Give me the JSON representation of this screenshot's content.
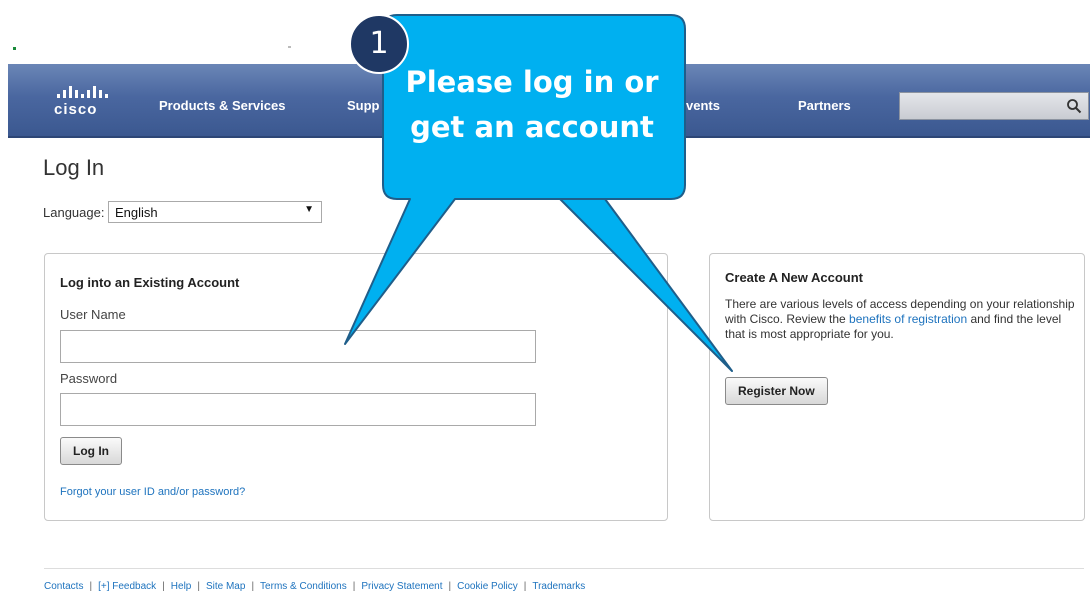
{
  "logo": {
    "text": "cisco"
  },
  "nav": {
    "items": [
      "Products & Services",
      "Supp",
      "vents",
      "Partners"
    ],
    "search_placeholder": ""
  },
  "page": {
    "title": "Log In"
  },
  "language": {
    "label": "Language:",
    "selected": "English"
  },
  "login_panel": {
    "heading": "Log into an Existing Account",
    "username_label": "User Name",
    "username_value": "",
    "password_label": "Password",
    "password_value": "",
    "login_button": "Log In",
    "forgot_link": "Forgot your user ID and/or password?"
  },
  "register_panel": {
    "heading": "Create A New Account",
    "desc_before": "There are various levels of access depending on your relationship with Cisco. Review the ",
    "desc_link": "benefits of registration",
    "desc_after": " and find the level that is most appropriate for you.",
    "register_button": "Register Now"
  },
  "footer": {
    "links": [
      "Contacts",
      "[+] Feedback",
      "Help",
      "Site Map",
      "Terms & Conditions",
      "Privacy Statement",
      "Cookie Policy",
      "Trademarks"
    ]
  },
  "callout": {
    "step_number": "1",
    "line1": "Please log in or",
    "line2": "get an account",
    "color": "#00b0f0",
    "badge_color": "#1f3864"
  }
}
